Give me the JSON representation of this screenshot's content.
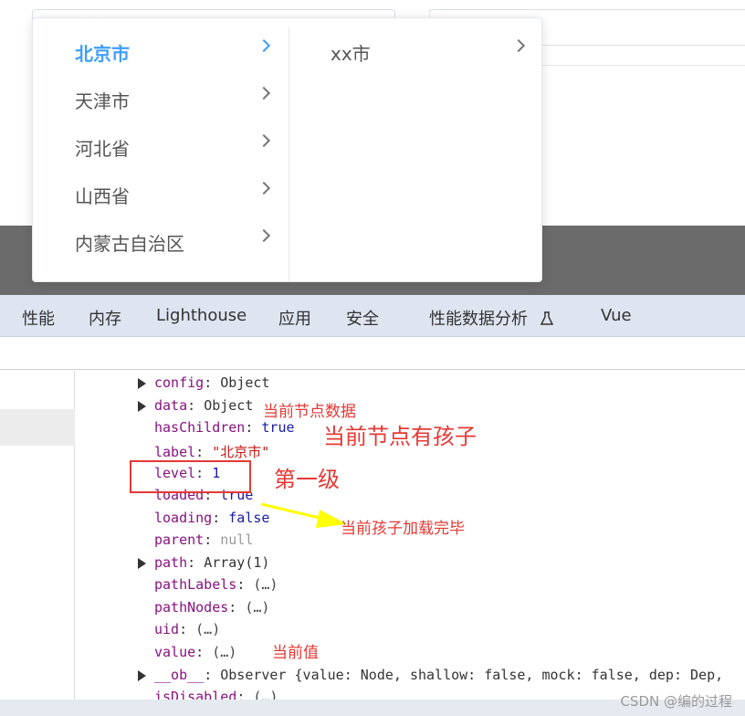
{
  "cascader": {
    "level1": [
      {
        "label": "北京市",
        "active": true
      },
      {
        "label": "天津市",
        "active": false
      },
      {
        "label": "河北省",
        "active": false
      },
      {
        "label": "山西省",
        "active": false
      },
      {
        "label": "内蒙古自治区",
        "active": false
      }
    ],
    "level2": [
      {
        "label": "xx市"
      }
    ]
  },
  "tabs": [
    "性能",
    "内存",
    "Lighthouse",
    "应用",
    "安全",
    "性能数据分析",
    "Vue"
  ],
  "properties": [
    {
      "key": "config",
      "value": "Object",
      "expandable": true
    },
    {
      "key": "data",
      "value": "Object",
      "expandable": true
    },
    {
      "key": "hasChildren",
      "value": "true",
      "expandable": false
    },
    {
      "key": "label",
      "value": "\"北京市\"",
      "expandable": false
    },
    {
      "key": "level",
      "value": "1",
      "expandable": false
    },
    {
      "key": "loaded",
      "value": "true",
      "expandable": false
    },
    {
      "key": "loading",
      "value": "false",
      "expandable": false
    },
    {
      "key": "parent",
      "value": "null",
      "expandable": false
    },
    {
      "key": "path",
      "value": "Array(1)",
      "expandable": true
    },
    {
      "key": "pathLabels",
      "value": "(…)",
      "expandable": false
    },
    {
      "key": "pathNodes",
      "value": "(…)",
      "expandable": false
    },
    {
      "key": "uid",
      "value": "(…)",
      "expandable": false
    },
    {
      "key": "value",
      "value": "(…)",
      "expandable": false
    },
    {
      "key": "__ob__",
      "value": "Observer  {value: Node, shallow: false, mock: false, dep: Dep,",
      "expandable": true
    },
    {
      "key": "isDisabled",
      "value": "(…)",
      "expandable": false
    }
  ],
  "annotations": {
    "data_note": "当前节点数据",
    "haschildren_note": "当前节点有孩子",
    "level_note": "第一级",
    "loaded_note": "当前孩子加载完毕",
    "value_note": "当前值"
  },
  "colors": {
    "accent": "#409eff",
    "annotation": "#e53935",
    "arrow": "#ffff00"
  },
  "watermark": "CSDN @编的过程"
}
